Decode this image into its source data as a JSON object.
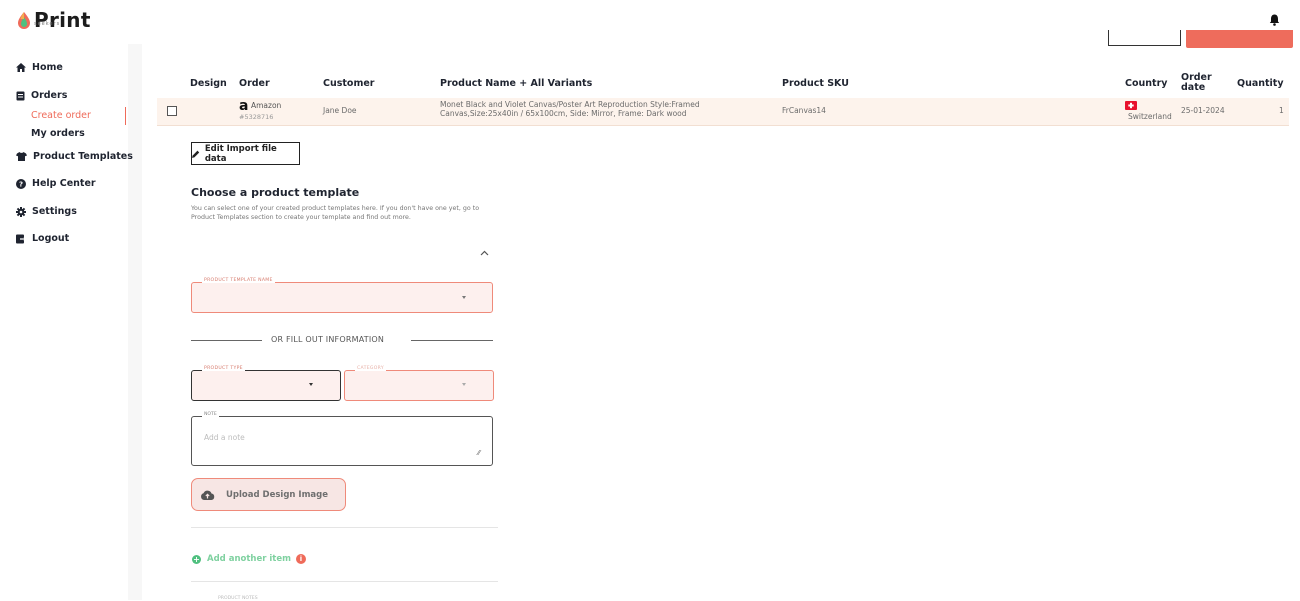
{
  "app": {
    "logo_text": "Print",
    "logo_subtext": "seekers"
  },
  "sidebar": {
    "items": [
      {
        "label": "Home",
        "icon": "home-icon"
      },
      {
        "label": "Orders",
        "icon": "orders-icon"
      },
      {
        "label": "Product Templates",
        "icon": "tshirt-icon"
      },
      {
        "label": "Help Center",
        "icon": "help-icon"
      },
      {
        "label": "Settings",
        "icon": "gear-icon"
      },
      {
        "label": "Logout",
        "icon": "logout-icon"
      }
    ],
    "orders_sub": [
      {
        "label": "Create order",
        "active": true
      },
      {
        "label": "My orders",
        "active": false
      }
    ]
  },
  "table": {
    "headers": [
      "Design",
      "Order",
      "Customer",
      "Product Name + All Variants",
      "Product SKU",
      "Country",
      "Order date",
      "Quantity"
    ],
    "rows": [
      {
        "order_source": "Amazon",
        "order_id": "#5328716",
        "customer": "Jane Doe",
        "product_name": "Monet Black and Violet Canvas/Poster Art Reproduction Style:Framed Canvas,Size:25x40in / 65x100cm, Side: Mirror, Frame: Dark wood",
        "sku": "FrCanvas14",
        "country": "Switzerland",
        "order_date": "25-01-2024",
        "quantity": "1"
      }
    ]
  },
  "actions": {
    "edit_import": "Edit Import file data"
  },
  "template_section": {
    "title": "Choose a product template",
    "description": "You can select one of your created product templates here. If you don't have one yet, go to Product Templates section to create your template and find out more.",
    "template_name_label": "PRODUCT TEMPLATE NAME",
    "or_text": "OR FILL OUT INFORMATION",
    "product_type_label": "PRODUCT TYPE",
    "category_label": "CATEGORY",
    "note_label": "NOTE",
    "note_placeholder": "Add a note",
    "upload_label": "Upload Design Image",
    "add_item_label": "Add another item",
    "bottom_label": "PRODUCT NOTES"
  },
  "colors": {
    "accent": "#ee6c5c",
    "success": "#4fc07f"
  }
}
